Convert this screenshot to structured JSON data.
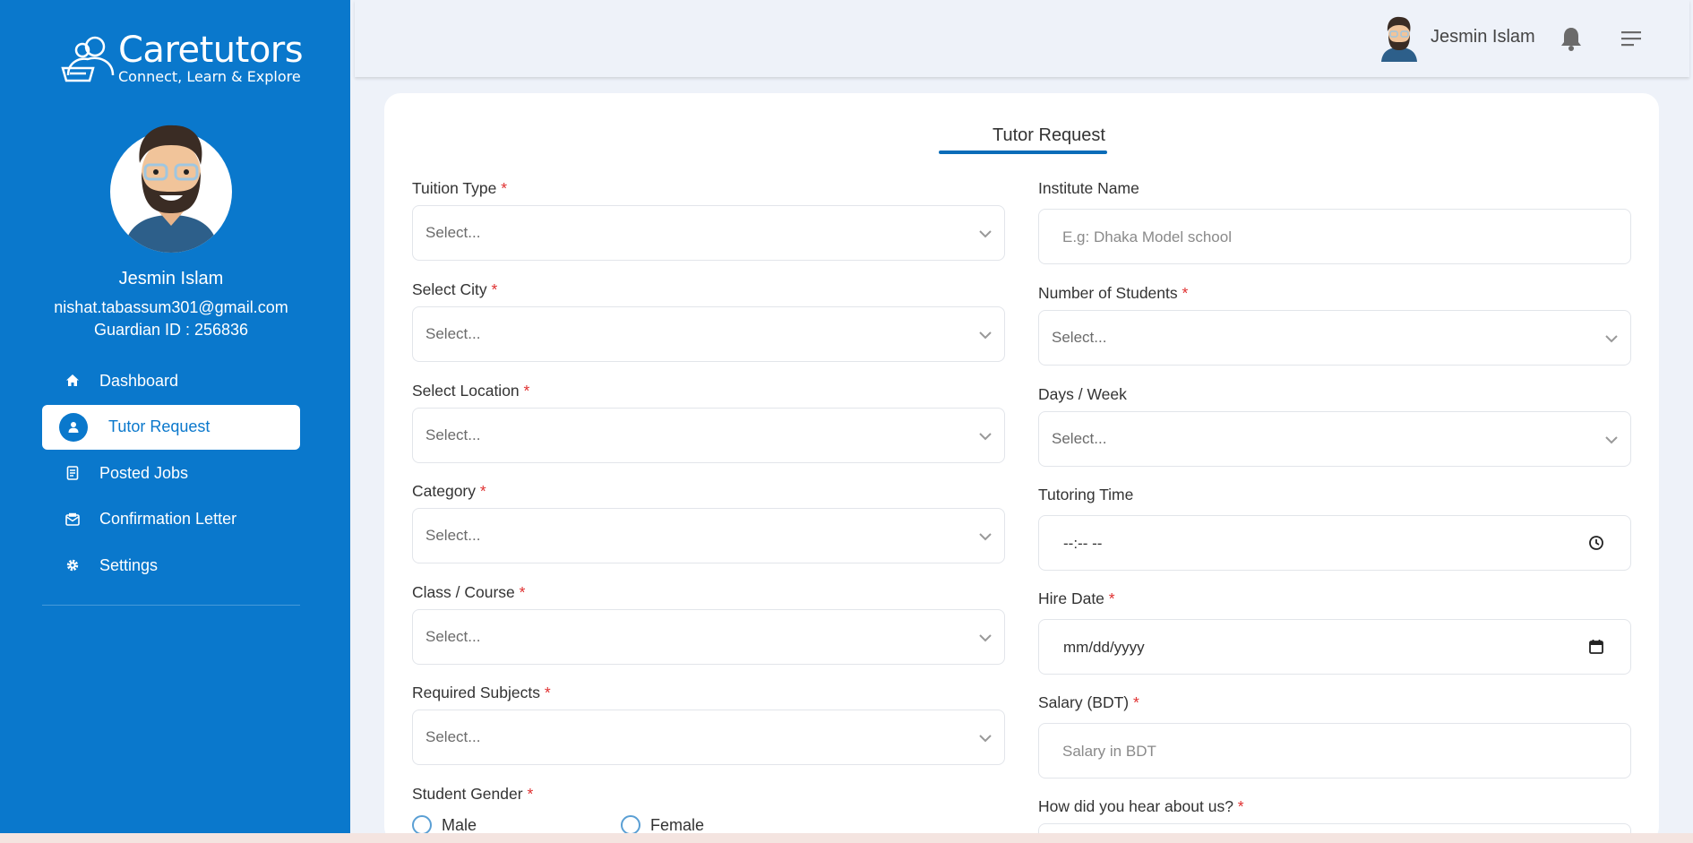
{
  "brand": {
    "name": "Caretutors",
    "tagline": "Connect, Learn & Explore"
  },
  "profile": {
    "name": "Jesmin Islam",
    "email": "nishat.tabassum301@gmail.com",
    "guardian_id": "Guardian ID : 256836"
  },
  "nav": [
    {
      "label": "Dashboard",
      "icon": "home-icon"
    },
    {
      "label": "Tutor Request",
      "icon": "user-icon",
      "active": true
    },
    {
      "label": "Posted Jobs",
      "icon": "document-icon"
    },
    {
      "label": "Confirmation Letter",
      "icon": "letter-icon"
    },
    {
      "label": "Settings",
      "icon": "gear-icon"
    }
  ],
  "header": {
    "user_name": "Jesmin Islam"
  },
  "form": {
    "title": "Tutor Request",
    "required_mark": "*",
    "tuition_type": {
      "label": "Tuition Type",
      "placeholder": "Select..."
    },
    "select_city": {
      "label": "Select City",
      "placeholder": "Select..."
    },
    "select_location": {
      "label": "Select Location",
      "placeholder": "Select..."
    },
    "category": {
      "label": "Category",
      "placeholder": "Select..."
    },
    "class_course": {
      "label": "Class / Course",
      "placeholder": "Select..."
    },
    "required_subjects": {
      "label": "Required Subjects",
      "placeholder": "Select..."
    },
    "student_gender": {
      "label": "Student Gender",
      "options": [
        "Male",
        "Female"
      ]
    },
    "institute_name": {
      "label": "Institute Name",
      "placeholder": "E.g: Dhaka Model school"
    },
    "number_of_students": {
      "label": "Number of Students",
      "placeholder": "Select..."
    },
    "days_week": {
      "label": "Days / Week",
      "placeholder": "Select..."
    },
    "tutoring_time": {
      "label": "Tutoring Time",
      "value": "--:-- --"
    },
    "hire_date": {
      "label": "Hire Date",
      "value": "mm/dd/yyyy"
    },
    "salary": {
      "label": "Salary (BDT)",
      "placeholder": "Salary in BDT"
    },
    "hear_about": {
      "label": "How did you hear about us?"
    }
  },
  "colors": {
    "primary": "#0a78cc",
    "required": "#e03131"
  }
}
